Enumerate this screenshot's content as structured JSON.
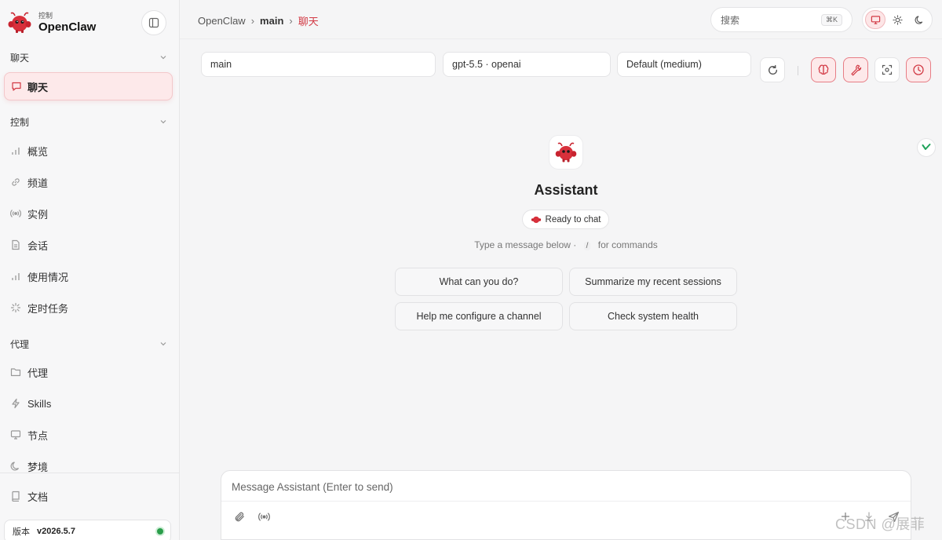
{
  "brand": {
    "subtitle": "控制",
    "name": "OpenClaw"
  },
  "sidebar": {
    "sections": [
      {
        "title": "聊天"
      },
      {
        "title": "控制"
      },
      {
        "title": "代理"
      }
    ],
    "active_item": "聊天",
    "control_items": [
      "概览",
      "频道",
      "实例",
      "会话",
      "使用情况",
      "定时任务"
    ],
    "agent_items": [
      "代理",
      "Skills",
      "节点",
      "梦境",
      "文档"
    ],
    "version_label": "版本",
    "version": "v2026.5.7"
  },
  "breadcrumb": [
    "OpenClaw",
    "main",
    "聊天"
  ],
  "search": {
    "placeholder": "搜索",
    "shortcut": "⌘K"
  },
  "selectors": {
    "session": "main",
    "model": "gpt-5.5 · openai",
    "thinking": "Default (medium)"
  },
  "assistant": {
    "name": "Assistant",
    "status": "Ready to chat",
    "hint_before": "Type a message below ·",
    "hint_key": "/",
    "hint_after": "for commands"
  },
  "suggestions": [
    "What can you do?",
    "Summarize my recent sessions",
    "Help me configure a channel",
    "Check system health"
  ],
  "composer": {
    "placeholder": "Message Assistant (Enter to send)"
  },
  "watermark": "CSDN @展菲",
  "colors": {
    "accent": "#d23a45",
    "active_bg": "#fde9ea",
    "online": "#2a9d4a"
  }
}
